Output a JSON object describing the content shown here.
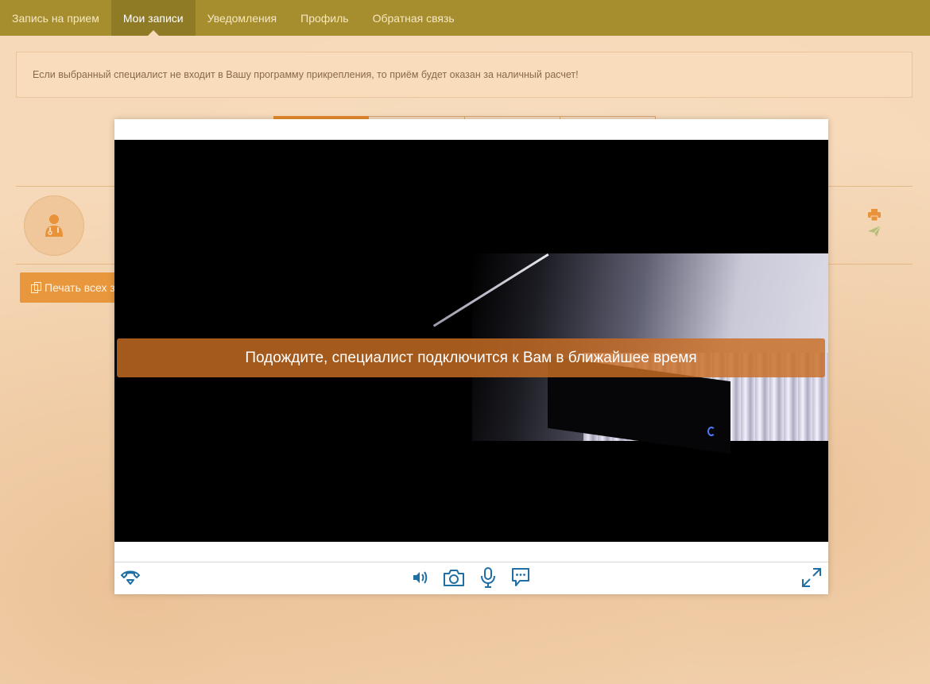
{
  "nav": {
    "items": [
      {
        "label": "Запись на прием"
      },
      {
        "label": "Мои записи",
        "active": true
      },
      {
        "label": "Уведомления"
      },
      {
        "label": "Профиль"
      },
      {
        "label": "Обратная связь"
      }
    ]
  },
  "info": {
    "text": "Если выбранный специалист не входит в Вашу программу прикрепления, то приём будет оказан за наличный расчет!"
  },
  "record": {
    "avatar_icon": "doctor-icon",
    "actions": [
      "print-icon",
      "send-icon"
    ]
  },
  "buttons": {
    "print_all_label": "Печать всех з"
  },
  "video_modal": {
    "wait_message": "Подождите, специалист подключится к Вам в ближайшее время",
    "controls": {
      "left": [
        "hangup-icon"
      ],
      "center": [
        "volume-icon",
        "camera-icon",
        "microphone-icon",
        "chat-icon"
      ],
      "right": [
        "fullscreen-icon"
      ]
    }
  },
  "colors": {
    "navbar": "#a68e2e",
    "accent": "#e58a2c",
    "icon_blue": "#1f6fa5",
    "banner": "#c86e23"
  }
}
